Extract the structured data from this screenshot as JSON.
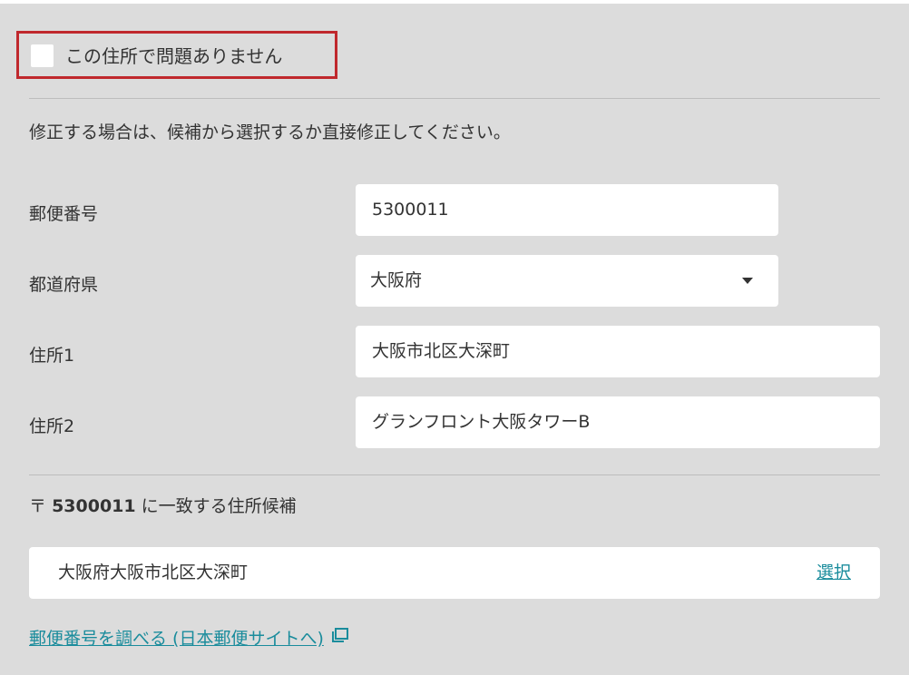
{
  "confirm": {
    "label": "この住所で問題ありません",
    "checked": false,
    "highlight_color": "#c0282d"
  },
  "instruction": "修正する場合は、候補から選択するか直接修正してください。",
  "fields": {
    "postal_code": {
      "label": "郵便番号",
      "value": "5300011"
    },
    "prefecture": {
      "label": "都道府県",
      "value": "大阪府"
    },
    "address1": {
      "label": "住所1",
      "value": "大阪市北区大深町"
    },
    "address2": {
      "label": "住所2",
      "value": "グランフロント大阪タワーB"
    }
  },
  "candidates": {
    "postal_mark": "〒",
    "zip": "5300011",
    "heading_suffix": "に一致する住所候補",
    "items": [
      {
        "address": "大阪府大阪市北区大深町",
        "select_label": "選択"
      }
    ]
  },
  "postal_lookup_link": "郵便番号を調べる (日本郵便サイトへ)",
  "colors": {
    "background": "#dcdcdc",
    "link": "#1a8c9c",
    "text": "#333333"
  },
  "icons": {
    "external_link": "external-link-icon",
    "dropdown": "chevron-down-icon"
  }
}
